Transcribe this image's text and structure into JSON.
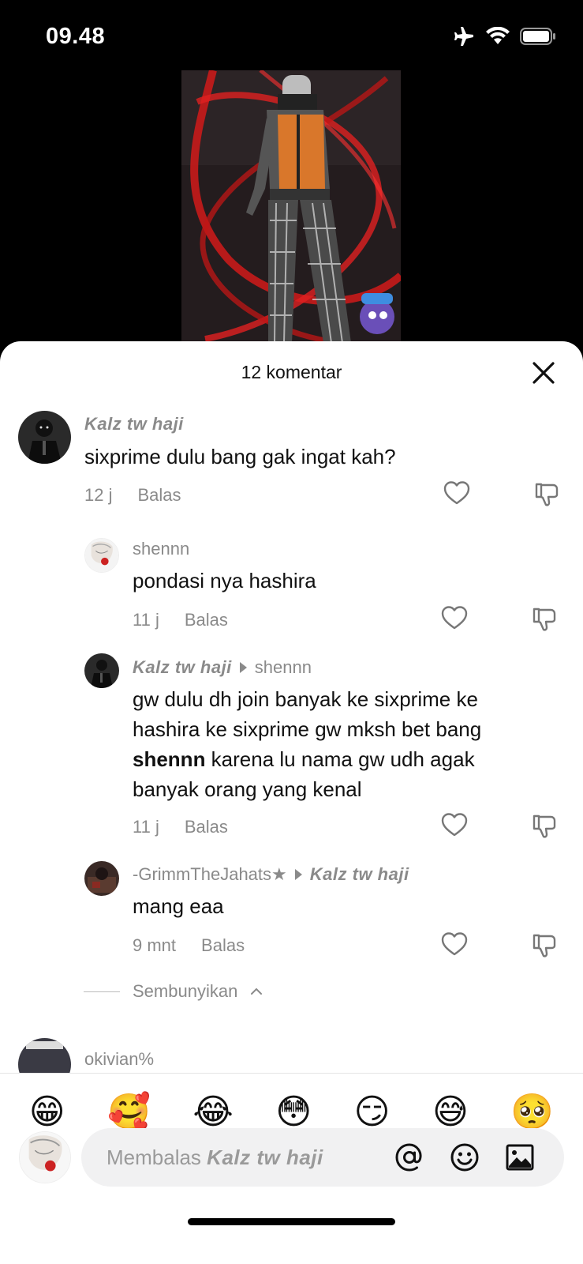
{
  "status_bar": {
    "time": "09.48",
    "icons": [
      "airplane-icon",
      "wifi-icon",
      "battery-icon"
    ]
  },
  "video": {
    "thumbnail": "video-thumbnail"
  },
  "sheet": {
    "title": "12 komentar",
    "close_icon": "close-icon"
  },
  "comments": [
    {
      "user": "Kalz tw haji",
      "text": "sixprime dulu bang gak ingat kah?",
      "time": "12 j",
      "reply_label": "Balas"
    },
    {
      "user": "shennn",
      "text": "pondasi nya hashira",
      "time": "11 j",
      "reply_label": "Balas"
    },
    {
      "user": "Kalz tw haji",
      "reply_to": "shennn",
      "text_line1": "gw dulu dh join banyak ke sixprime ke",
      "text_line2": "hashira ke sixprime gw mksh bet bang",
      "text_mention": "shennn",
      "text_line3_rest": " karena lu nama gw udh agak",
      "text_line4": "banyak orang yang kenal",
      "time": "11 j",
      "reply_label": "Balas"
    },
    {
      "user": "-GrimmTheJahats★",
      "reply_to": "Kalz tw haji",
      "text": "mang eaa",
      "time": "9 mnt",
      "reply_label": "Balas"
    }
  ],
  "hide_replies": {
    "label": "Sembunyikan"
  },
  "partial_comment": {
    "user": "okivian%"
  },
  "emoji_bar": [
    "😁",
    "🥰",
    "😂",
    "😳",
    "😏",
    "😅",
    "🥺"
  ],
  "reply_box": {
    "prefix": "Membalas",
    "target": "Kalz tw haji",
    "icons": [
      "mention-icon",
      "emoji-icon",
      "image-icon"
    ]
  }
}
